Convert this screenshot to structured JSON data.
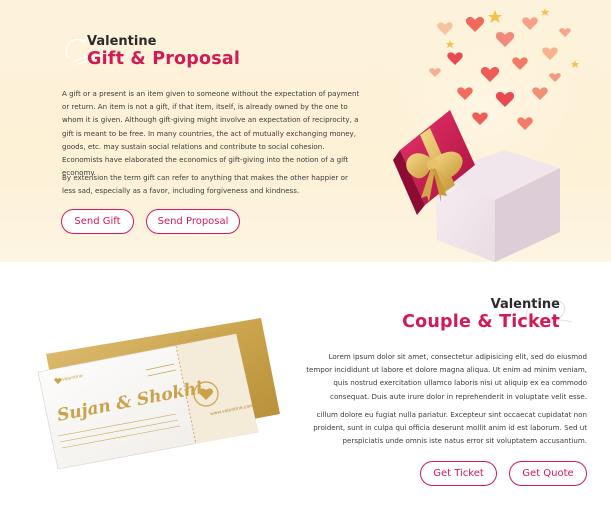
{
  "gift_section": {
    "kicker": "Valentine",
    "title": "Gift & Proposal",
    "paragraph1": "A gift or a present is an item given to someone without the expectation of payment or return. An item is not a gift, if that item, itself, is already owned by the one to whom it is given. Although gift-giving might involve an expectation of reciprocity, a gift is meant to be free. In many countries, the act of mutually exchanging money, goods, etc. may sustain social relations and contribute to social cohesion. Economists have elaborated the economics of gift-giving into the notion of a gift economy.",
    "paragraph2": "By extension the term gift can refer to anything that makes the other happier or less sad, especially as a favor, including forgiveness and kindness.",
    "buttons": {
      "send_gift": "Send Gift",
      "send_proposal": "Send Proposal"
    }
  },
  "ticket_section": {
    "kicker": "Valentine",
    "title": "Couple & Ticket",
    "paragraph1": "Lorem ipsum dolor sit amet, consectetur adipisicing elit, sed do eiusmod tempor incididunt ut labore et dolore magna aliqua. Ut enim ad minim veniam, quis nostrud exercitation ullamco laboris nisi ut aliquip ex ea commodo consequat. Duis aute irure dolor in reprehenderit in voluptate velit esse.",
    "paragraph2": "cillum dolore eu fugiat nulla pariatur. Excepteur sint occaecat cupidatat non proident, sunt in culpa qui officia deserunt mollit anim id est laborum. Sed ut perspiciatis unde omnis iste natus error sit voluptatem accusantium.",
    "buttons": {
      "get_ticket": "Get Ticket",
      "get_quote": "Get Quote"
    }
  },
  "ticket_image": {
    "names": "Sujan & Shokhi",
    "badge": "Confirmed",
    "brand": "Valentine",
    "url": "www.valentine.com"
  },
  "colors": {
    "accent": "#d21a55",
    "heading_dark": "#2e2a2a",
    "cream": "#fdf3dc",
    "gold": "#c9a24a"
  }
}
